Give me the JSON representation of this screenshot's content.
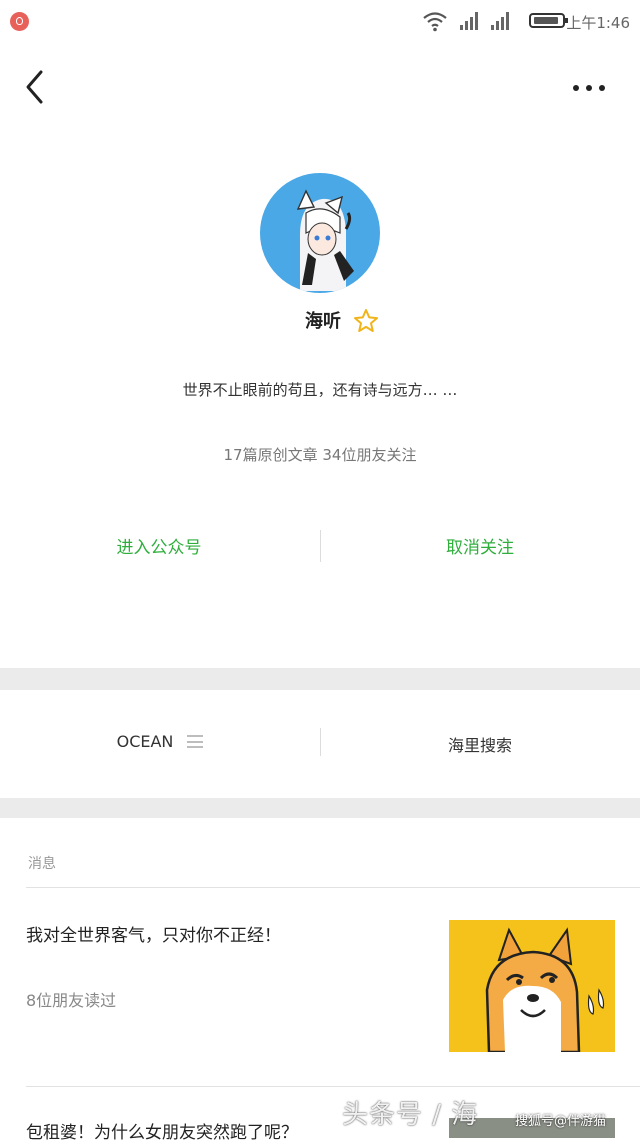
{
  "status_bar": {
    "time": "上午1:46"
  },
  "profile": {
    "name": "海听",
    "bio": "世界不止眼前的苟且，还有诗与远方… …",
    "stats": "17篇原创文章  34位朋友关注"
  },
  "actions": {
    "enter": "进入公众号",
    "unfollow": "取消关注"
  },
  "menu": {
    "ocean": "OCEAN",
    "search": "海里搜索"
  },
  "messages": {
    "label": "消息",
    "items": [
      {
        "title": "我对全世界客气，只对你不正经！",
        "reads": "8位朋友读过"
      },
      {
        "title": "包租婆！为什么女朋友突然跑了呢？"
      }
    ]
  },
  "watermark": {
    "text": "头条号 / 海",
    "credit": "搜狐号@伴游猫"
  },
  "colors": {
    "accent_green": "#2fae3c",
    "avatar_bg": "#4aa8e6",
    "thumb_bg": "#f5c21b"
  }
}
